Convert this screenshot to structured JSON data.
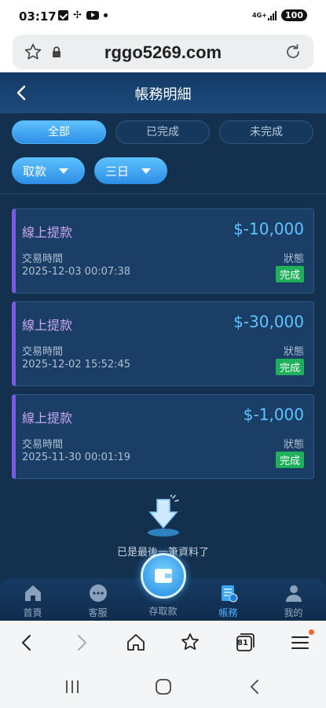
{
  "status_bar": {
    "time": "03:17",
    "network": "4G+",
    "battery": "100"
  },
  "browser": {
    "url": "rggo5269.com",
    "tab_count": "81"
  },
  "header": {
    "title": "帳務明細"
  },
  "tabs": [
    {
      "label": "全部",
      "active": true
    },
    {
      "label": "已完成",
      "active": false
    },
    {
      "label": "未完成",
      "active": false
    }
  ],
  "filters": {
    "type": "取款",
    "range": "三日"
  },
  "records": [
    {
      "type": "線上提款",
      "amount": "$-10,000",
      "time_label": "交易時間",
      "time": "2025-12-03 00:07:38",
      "status_label": "狀態",
      "status": "完成"
    },
    {
      "type": "線上提款",
      "amount": "$-30,000",
      "time_label": "交易時間",
      "time": "2025-12-02 15:52:45",
      "status_label": "狀態",
      "status": "完成"
    },
    {
      "type": "線上提款",
      "amount": "$-1,000",
      "time_label": "交易時間",
      "time": "2025-11-30 00:01:19",
      "status_label": "狀態",
      "status": "完成"
    }
  ],
  "end_message": "已是最後一筆資料了",
  "bottom_nav": [
    {
      "label": "首頁",
      "icon": "home-icon"
    },
    {
      "label": "客服",
      "icon": "chat-icon"
    },
    {
      "label": "存取款",
      "icon": "wallet-icon"
    },
    {
      "label": "帳務",
      "icon": "ledger-icon",
      "active": true
    },
    {
      "label": "我的",
      "icon": "user-icon"
    }
  ],
  "colors": {
    "accent": "#4fb6ff",
    "status_complete": "#1fb15a",
    "record_type": "#c8a6f0",
    "amount": "#5ec3ff"
  }
}
